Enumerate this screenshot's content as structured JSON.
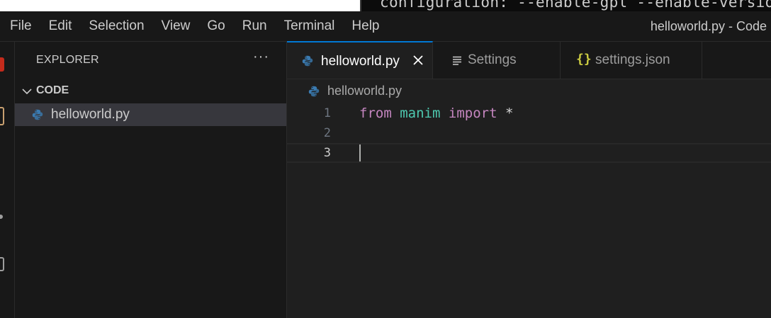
{
  "background_terminal": {
    "text": "configuration: --enable-gpl --enable-versio"
  },
  "menubar": {
    "items": [
      "File",
      "Edit",
      "Selection",
      "View",
      "Go",
      "Run",
      "Terminal",
      "Help"
    ],
    "window_title": "helloworld.py - Code"
  },
  "sidebar": {
    "title": "EXPLORER",
    "more_actions": "···",
    "section": "CODE",
    "files": [
      {
        "name": "helloworld.py",
        "icon": "python-file-icon",
        "selected": true
      }
    ]
  },
  "tabs": [
    {
      "label": "helloworld.py",
      "icon": "python-file-icon",
      "active": true,
      "close": "×"
    },
    {
      "label": "Settings",
      "icon": "settings-list-icon",
      "active": false
    },
    {
      "label": "settings.json",
      "icon": "json-braces-icon",
      "icon_glyph": "{}",
      "active": false
    }
  ],
  "breadcrumb": {
    "file": "helloworld.py"
  },
  "editor": {
    "lines": [
      {
        "number": "1",
        "tokens": [
          {
            "text": "from",
            "type": "keyword"
          },
          {
            "text": " ",
            "type": "plain"
          },
          {
            "text": "manim",
            "type": "module"
          },
          {
            "text": " ",
            "type": "plain"
          },
          {
            "text": "import",
            "type": "keyword"
          },
          {
            "text": " *",
            "type": "operator"
          }
        ]
      },
      {
        "number": "2",
        "tokens": []
      },
      {
        "number": "3",
        "tokens": [],
        "current": true
      }
    ]
  },
  "colors": {
    "accent": "#0078d4",
    "keyword": "#c586c0",
    "module": "#4ec9b0",
    "python_blue": "#3a7ab0",
    "python_yellow": "#f5d04a",
    "json_yellow": "#cbcb41"
  }
}
